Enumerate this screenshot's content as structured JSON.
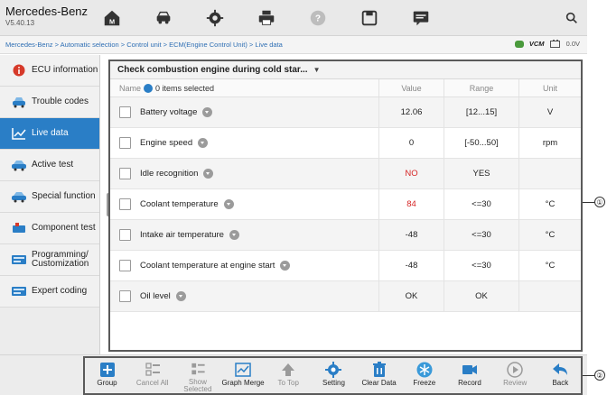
{
  "header": {
    "brand": "Mercedes-Benz",
    "version": "V5.40.13"
  },
  "toolbar_icons": [
    "home-icon",
    "vehicle-icon",
    "settings-icon",
    "print-icon",
    "help-icon",
    "save-icon",
    "message-icon",
    "search-icon"
  ],
  "breadcrumb": "Mercedes-Benz > Automatic selection > Control unit > ECM(Engine Control Unit) > Live data",
  "status": {
    "vcm": "VCM",
    "voltage": "0.0V"
  },
  "sidebar": {
    "items": [
      {
        "label": "ECU information",
        "icon": "info-icon"
      },
      {
        "label": "Trouble codes",
        "icon": "car-warning-icon"
      },
      {
        "label": "Live data",
        "icon": "graph-icon",
        "active": true
      },
      {
        "label": "Active test",
        "icon": "car-test-icon"
      },
      {
        "label": "Special function",
        "icon": "car-special-icon"
      },
      {
        "label": "Component test",
        "icon": "component-icon"
      },
      {
        "label": "Programming/\nCustomization",
        "icon": "program-icon"
      },
      {
        "label": "Expert coding",
        "icon": "coding-icon"
      }
    ]
  },
  "main": {
    "dropdown": "Check combustion engine during cold star...",
    "columns": {
      "name": "Name",
      "selected": "0 items selected",
      "value": "Value",
      "range": "Range",
      "unit": "Unit"
    },
    "rows": [
      {
        "name": "Battery voltage",
        "value": "12.06",
        "range": "[12...15]",
        "unit": "V",
        "alert": false
      },
      {
        "name": "Engine speed",
        "value": "0",
        "range": "[-50...50]",
        "unit": "rpm",
        "alert": false
      },
      {
        "name": "Idle recognition",
        "value": "NO",
        "range": "YES",
        "unit": "",
        "alert": true
      },
      {
        "name": "Coolant temperature",
        "value": "84",
        "range": "<=30",
        "unit": "°C",
        "alert": true
      },
      {
        "name": "Intake air temperature",
        "value": "-48",
        "range": "<=30",
        "unit": "°C",
        "alert": false
      },
      {
        "name": "Coolant temperature at engine start",
        "value": "-48",
        "range": "<=30",
        "unit": "°C",
        "alert": false
      },
      {
        "name": "Oil level",
        "value": "OK",
        "range": "OK",
        "unit": "",
        "alert": false
      }
    ]
  },
  "bottom_toolbar": [
    {
      "label": "Group",
      "icon": "plus-icon",
      "enabled": true
    },
    {
      "label": "Cancel All",
      "icon": "list-cancel-icon",
      "enabled": false
    },
    {
      "label": "Show\nSelected",
      "icon": "list-check-icon",
      "enabled": false
    },
    {
      "label": "Graph Merge",
      "icon": "graph-merge-icon",
      "enabled": true
    },
    {
      "label": "To Top",
      "icon": "to-top-icon",
      "enabled": false
    },
    {
      "label": "Setting",
      "icon": "setting-icon",
      "enabled": true
    },
    {
      "label": "Clear Data",
      "icon": "trash-icon",
      "enabled": true
    },
    {
      "label": "Freeze",
      "icon": "freeze-icon",
      "enabled": true
    },
    {
      "label": "Record",
      "icon": "record-icon",
      "enabled": true
    },
    {
      "label": "Review",
      "icon": "review-icon",
      "enabled": false
    },
    {
      "label": "Back",
      "icon": "back-icon",
      "enabled": true
    }
  ],
  "callouts": [
    "①",
    "②"
  ],
  "colors": {
    "accent": "#2a7ec6",
    "alert": "#d62626",
    "disabled": "#8a8a8a"
  }
}
